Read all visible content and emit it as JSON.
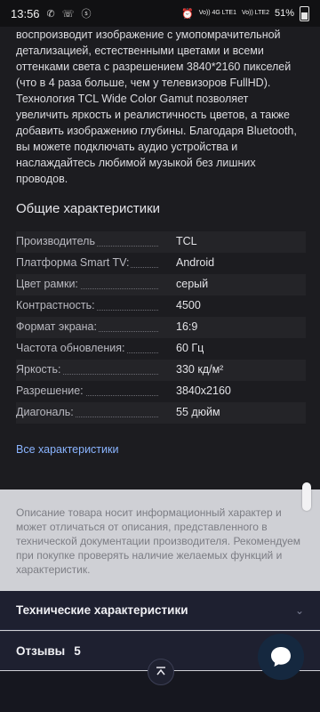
{
  "status_bar": {
    "time": "13:56",
    "network1": "Vo)) 4G LTE1",
    "network2": "Vo)) LTE2",
    "battery": "51%"
  },
  "description": "воспроизводит изображение с умопомрачительной детализацией, естественными цветами и всеми оттенками света с разрешением 3840*2160 пикселей (что в 4 раза больше, чем у телевизоров FullHD). Технология TCL Wide Color Gamut позволяет увеличить яркость и реалистичность цветов, а также добавить изображению глубины. Благодаря Bluetooth, вы можете подключать аудио устройства и наслаждайтесь любимой музыкой без лишних проводов.",
  "specs": {
    "title": "Общие характеристики",
    "rows": [
      {
        "label": "Производитель",
        "value": "TCL"
      },
      {
        "label": "Платформа Smart TV:",
        "value": "Android"
      },
      {
        "label": "Цвет рамки:",
        "value": "серый"
      },
      {
        "label": "Контрастность:",
        "value": "4500"
      },
      {
        "label": "Формат экрана:",
        "value": "16:9"
      },
      {
        "label": "Частота обновления:",
        "value": "60 Гц"
      },
      {
        "label": "Яркость:",
        "value": "330 кд/м²"
      },
      {
        "label": "Разрешение:",
        "value": "3840x2160"
      },
      {
        "label": "Диагональ:",
        "value": "55 дюйм"
      }
    ],
    "all_link": "Все характеристики"
  },
  "disclaimer": "Описание товара носит информационный характер и может отличаться от описания, представленного в технической документации производителя. Рекомендуем при покупке проверять наличие желаемых функций и характеристик.",
  "accordion": {
    "tech_label": "Технические характеристики",
    "reviews_label": "Отзывы",
    "reviews_count": "5"
  },
  "icons": {
    "scroll_top": "chevron-up-icon",
    "chat": "chat-bubble-icon"
  },
  "colors": {
    "background": "#1c1c20",
    "link": "#8ab4ff",
    "accordion": "#1e2030",
    "overlay": "#cfd0d5"
  }
}
